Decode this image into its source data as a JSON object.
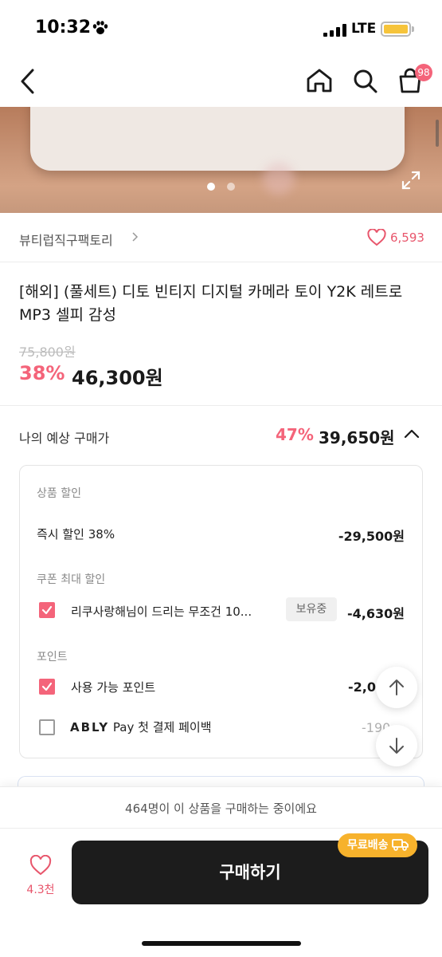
{
  "status_bar": {
    "time": "10:32",
    "network": "LTE"
  },
  "nav": {
    "cart_badge": "98"
  },
  "store": {
    "name": "뷰티럽직구팩토리",
    "like_count": "6,593"
  },
  "product": {
    "title": "[해외] (풀세트) 디토 빈티지 디지털 카메라 토이 Y2K 레트로 MP3 셀피 감성",
    "original_price": "75,800원",
    "discount_rate": "38%",
    "price": "46,300원"
  },
  "expected_price": {
    "label": "나의 예상 구매가",
    "discount_rate": "47%",
    "price": "39,650원"
  },
  "discount_detail": {
    "product_discount": {
      "label": "상품 할인",
      "instant_label": "즉시 할인 38%",
      "instant_amount": "-29,500원"
    },
    "coupon": {
      "label": "쿠폰 최대 할인",
      "name": "리쿠사랑해님이 드리는 무조건 10...",
      "tag": "보유중",
      "amount": "-4,630원"
    },
    "points": {
      "label": "포인트",
      "available_label": "사용 가능 포인트",
      "available_amount": "-2,0",
      "ably_brand": "ABLY",
      "ably_pay": "Pay",
      "ably_text": "첫 결제 페이백",
      "ably_amount": "-19",
      "ably_amount_suffix": "0"
    }
  },
  "notice": {
    "text": "464명이 이 상품을 구매하는 중이에요"
  },
  "bottom_bar": {
    "favorite_count": "4.3천",
    "buy_label": "구매하기",
    "free_shipping": "무료배송"
  },
  "colors": {
    "accent": "#f4647a",
    "buy_button": "#1c1c1c",
    "free_shipping": "#f7b22c"
  }
}
